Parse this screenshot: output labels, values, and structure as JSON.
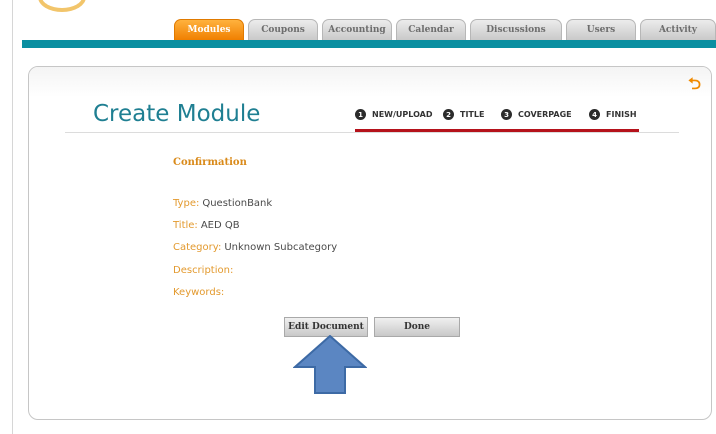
{
  "nav": {
    "tabs": [
      {
        "label": "Modules",
        "active": true
      },
      {
        "label": "Coupons",
        "active": false
      },
      {
        "label": "Accounting",
        "active": false
      },
      {
        "label": "Calendar",
        "active": false
      },
      {
        "label": "Discussions",
        "active": false
      },
      {
        "label": "Users",
        "active": false
      },
      {
        "label": "Activity",
        "active": false
      }
    ]
  },
  "page": {
    "title": "Create Module",
    "steps": [
      {
        "number": "1",
        "label": "NEW/UPLOAD"
      },
      {
        "number": "2",
        "label": "TITLE"
      },
      {
        "number": "3",
        "label": "COVERPAGE"
      },
      {
        "number": "4",
        "label": "FINISH"
      }
    ]
  },
  "confirmation": {
    "heading": "Confirmation",
    "fields": [
      {
        "label": "Type:",
        "value": "QuestionBank"
      },
      {
        "label": "Title:",
        "value": "AED QB"
      },
      {
        "label": "Category:",
        "value": "Unknown Subcategory"
      },
      {
        "label": "Description:",
        "value": ""
      },
      {
        "label": "Keywords:",
        "value": ""
      }
    ]
  },
  "actions": {
    "edit_label": "Edit Document",
    "done_label": "Done"
  },
  "icons": {
    "back": "back-arrow-icon",
    "pointer": "up-arrow-icon"
  },
  "colors": {
    "teal": "#0a8fa1",
    "orange": "#f07f00",
    "red": "#b5121b",
    "arrow": "#5b86c2"
  }
}
